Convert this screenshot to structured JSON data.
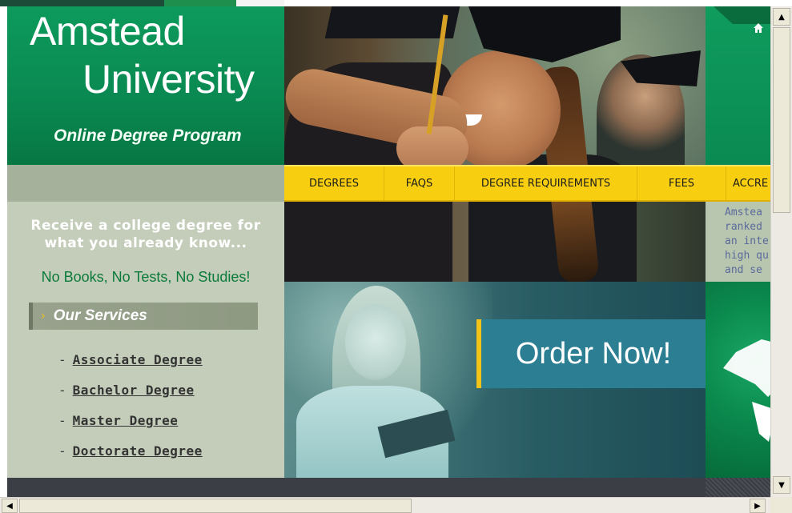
{
  "header": {
    "logo_line1": "Amstead",
    "logo_line2": "University",
    "tagline": "Online Degree Program"
  },
  "nav": {
    "items": [
      {
        "label": "DEGREES"
      },
      {
        "label": "FAQS"
      },
      {
        "label": "DEGREE REQUIREMENTS"
      },
      {
        "label": "FEES"
      },
      {
        "label": "ACCRE"
      }
    ]
  },
  "right_panel": {
    "home_icon": "home-icon",
    "lines": [
      "Amstea",
      "ranked",
      "an inte",
      "high qu",
      "and se"
    ]
  },
  "sidebar": {
    "promo_line1": "Receive a college degree for",
    "promo_line2": "what you already know...",
    "slogan": "No Books, No Tests, No Studies!",
    "services_arrow": "›",
    "services_title": "Our Services",
    "services": [
      {
        "dash": "-",
        "label": "Associate Degree"
      },
      {
        "dash": "-",
        "label": "Bachelor Degree"
      },
      {
        "dash": "-",
        "label": "Master Degree"
      },
      {
        "dash": "-",
        "label": "Doctorate Degree"
      }
    ]
  },
  "order": {
    "label": "Order Now!"
  },
  "scrollbars": {
    "up_arrow": "▲",
    "down_arrow": "▼",
    "left_arrow": "◀",
    "right_arrow": "▶"
  },
  "colors": {
    "brand_green": "#0a8a52",
    "nav_yellow": "#f8cf10",
    "sidebar_bg": "#c4cdb9",
    "slogan_green": "#0a7a3a",
    "order_blue": "#2c7f93"
  }
}
